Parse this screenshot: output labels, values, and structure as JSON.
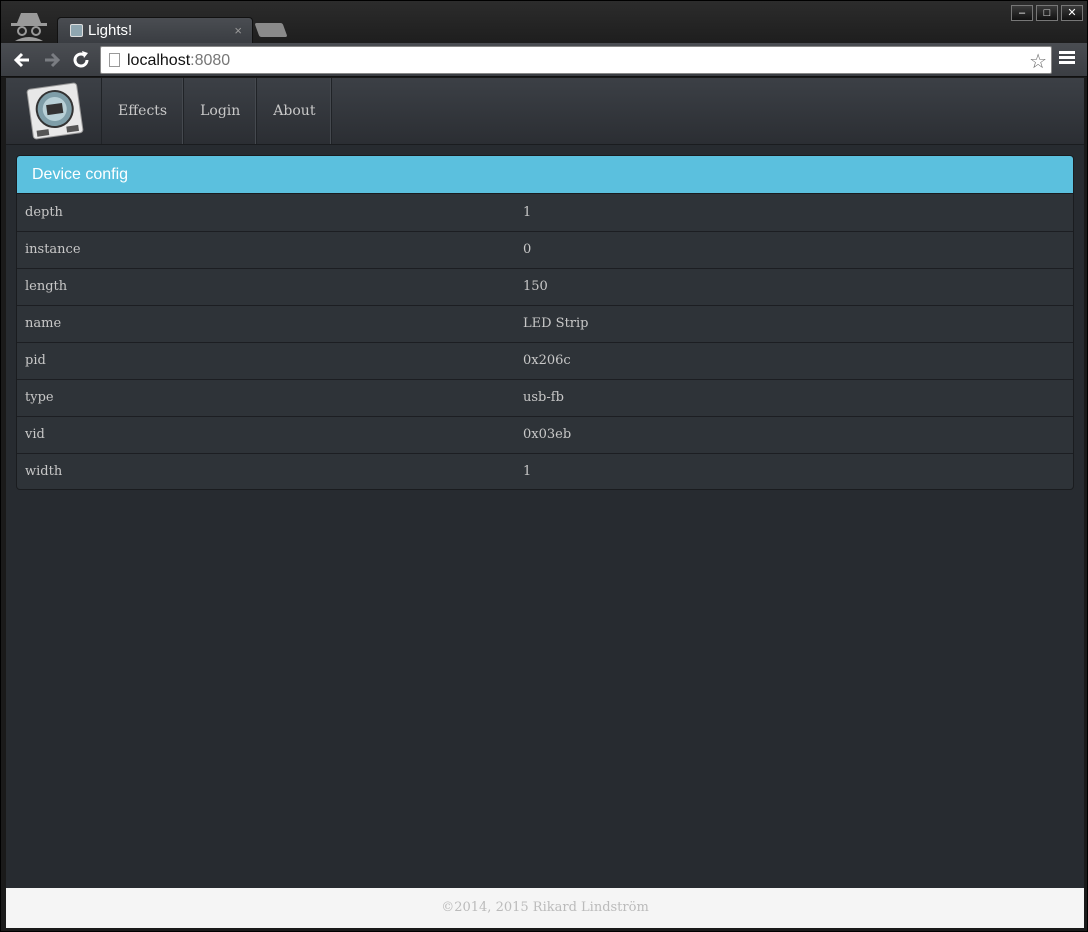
{
  "browser": {
    "tab_title": "Lights!",
    "tab_close": "×",
    "url_host": "localhost",
    "url_port": ":8080",
    "window_minimize": "–",
    "window_maximize": "□",
    "window_close": "✕"
  },
  "nav": {
    "items": [
      {
        "label": "Effects"
      },
      {
        "label": "Login"
      },
      {
        "label": "About"
      }
    ]
  },
  "panel": {
    "title": "Device config",
    "rows": [
      {
        "key": "depth",
        "value": "1"
      },
      {
        "key": "instance",
        "value": "0"
      },
      {
        "key": "length",
        "value": "150"
      },
      {
        "key": "name",
        "value": "LED Strip"
      },
      {
        "key": "pid",
        "value": "0x206c"
      },
      {
        "key": "type",
        "value": "usb-fb"
      },
      {
        "key": "vid",
        "value": "0x03eb"
      },
      {
        "key": "width",
        "value": "1"
      }
    ]
  },
  "footer": {
    "text": "©2014, 2015 Rikard Lindström"
  },
  "colors": {
    "panel_heading": "#5bc0de",
    "page_background": "#272b30"
  }
}
